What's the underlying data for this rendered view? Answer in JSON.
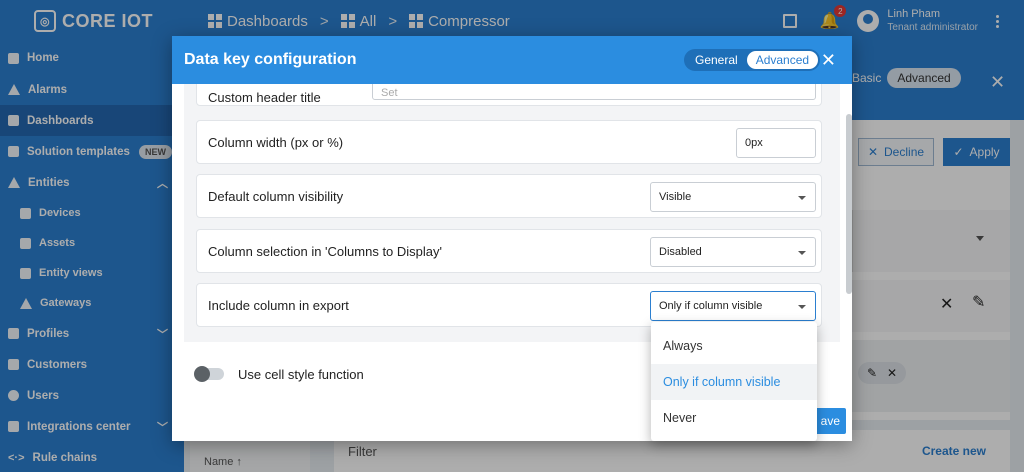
{
  "app": {
    "logo": "CORE IOT"
  },
  "breadcrumb": [
    {
      "label": "Dashboards"
    },
    {
      "label": "All"
    },
    {
      "label": "Compressor"
    }
  ],
  "notifications": {
    "count": "2"
  },
  "user": {
    "name": "Linh Pham",
    "role": "Tenant administrator"
  },
  "sidebar": {
    "items": [
      {
        "label": "Home"
      },
      {
        "label": "Alarms"
      },
      {
        "label": "Dashboards"
      },
      {
        "label": "Solution templates",
        "badge": "NEW"
      },
      {
        "label": "Entities"
      },
      {
        "label": "Devices"
      },
      {
        "label": "Assets"
      },
      {
        "label": "Entity views"
      },
      {
        "label": "Gateways"
      },
      {
        "label": "Profiles"
      },
      {
        "label": "Customers"
      },
      {
        "label": "Users"
      },
      {
        "label": "Integrations center"
      },
      {
        "label": "Rule chains"
      }
    ]
  },
  "background": {
    "mode_basic": "Basic",
    "mode_advanced": "Advanced",
    "decline": "Decline",
    "apply": "Apply",
    "filter": "Filter",
    "create_new": "Create new",
    "name_col": "Name ↑"
  },
  "dialog": {
    "title": "Data key configuration",
    "mode_general": "General",
    "mode_advanced": "Advanced",
    "partial_row": {
      "label": "Custom header title",
      "placeholder": "Set"
    },
    "rows": [
      {
        "label": "Column width (px or %)",
        "value": "0px"
      },
      {
        "label": "Default column visibility",
        "value": "Visible"
      },
      {
        "label": "Column selection in 'Columns to Display'",
        "value": "Disabled"
      },
      {
        "label": "Include column in export",
        "value": "Only if column visible"
      }
    ],
    "cell_style_label": "Use cell style function",
    "save_label": "ave"
  },
  "dropdown": {
    "options": [
      "Always",
      "Only if column visible",
      "Never"
    ],
    "selected": "Only if column visible"
  }
}
